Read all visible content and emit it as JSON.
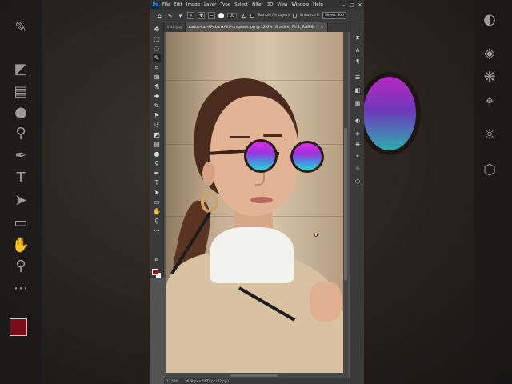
{
  "menu": {
    "logo": "Ps",
    "items": [
      "File",
      "Edit",
      "Image",
      "Layer",
      "Type",
      "Select",
      "Filter",
      "3D",
      "View",
      "Window",
      "Help"
    ],
    "window_controls": [
      "–",
      "□",
      "✕"
    ]
  },
  "options_bar": {
    "home_icon": "home-icon",
    "brush_size": "30",
    "sample_all_layers_label": "Sample All Layers",
    "enhance_edge_label": "Enhance E",
    "select_subject_label": "Select Sub"
  },
  "tabs": [
    {
      "label": "klab.jpg",
      "active": false
    },
    {
      "label": "carlos-vaz-KP4bxnxAilU-unsplash.jpg @ 22,6% (Gradient Fill 1, RGB/8) *",
      "active": true,
      "close": "✕"
    }
  ],
  "status": {
    "zoom": "22,59%",
    "doc_size": "3648 px x 5472 px (72 ppi)"
  },
  "colors": {
    "foreground": "#9e0b1c",
    "background": "#ffffff",
    "lens_gradient_top": "#e02be6",
    "lens_gradient_bottom": "#2ad8d0"
  },
  "toolbar_icons": [
    "move-icon",
    "marquee-icon",
    "lasso-icon",
    "quick-select-icon",
    "crop-icon",
    "frame-icon",
    "eyedropper-icon",
    "spot-heal-icon",
    "brush-icon",
    "clone-stamp-icon",
    "history-brush-icon",
    "eraser-icon",
    "gradient-icon",
    "blur-icon",
    "dodge-icon",
    "pen-icon",
    "type-icon",
    "path-select-icon",
    "rectangle-icon",
    "hand-icon",
    "zoom-icon",
    "more-tools-icon"
  ],
  "panel_icons": [
    "history-icon",
    "character-icon",
    "paragraph-icon",
    "properties-icon",
    "adjustments-icon",
    "swatches-icon",
    "layers-icon",
    "channels-icon",
    "paths-icon",
    "brush-settings-icon",
    "learn-icon",
    "libraries-icon"
  ]
}
